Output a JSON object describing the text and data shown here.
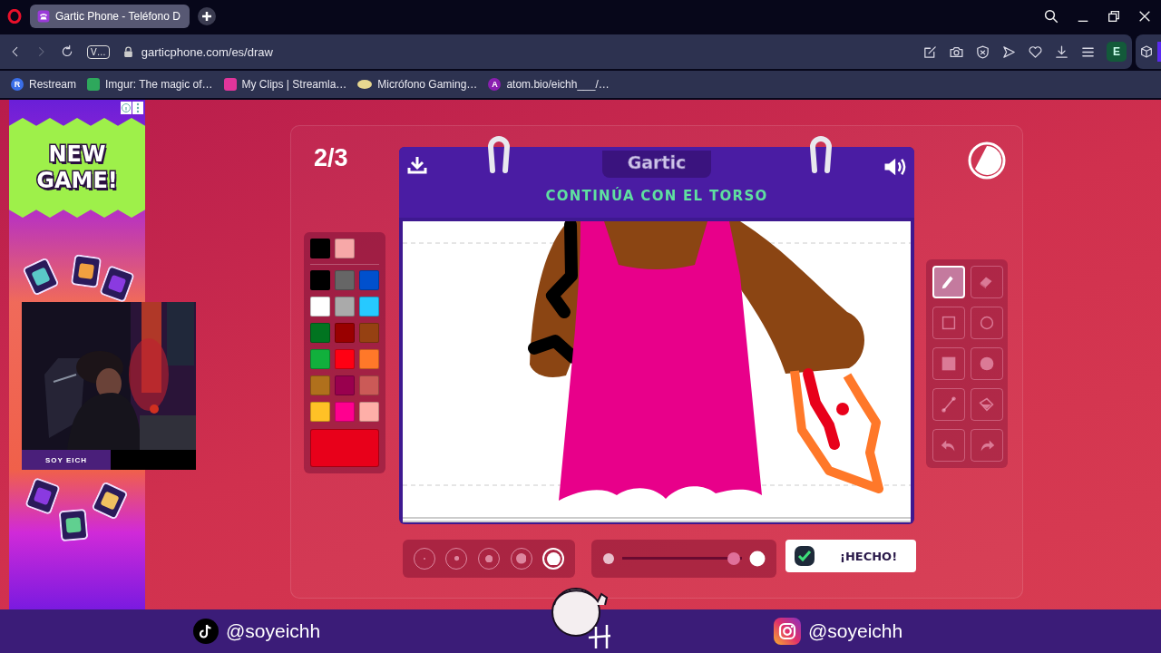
{
  "browser": {
    "tab": {
      "title": "Gartic Phone - Teléfono D",
      "selected": true
    },
    "forward_disabled": true,
    "site_badge": "V…",
    "url": "garticphone.com/es/draw",
    "profile_initial": "E",
    "bookmarks": [
      {
        "kind": "letter",
        "badge": "R",
        "color": "#3a6ee8",
        "label": "Restream"
      },
      {
        "kind": "square",
        "color": "#2ea85c",
        "label": "Imgur: The magic of…"
      },
      {
        "kind": "square",
        "color": "#e0359a",
        "label": "My Clips | Streamla…"
      },
      {
        "kind": "oval",
        "color": "#e8d890",
        "label": "Micrófono Gaming…"
      },
      {
        "kind": "letter",
        "badge": "A",
        "color": "#8a1fb0",
        "label": "atom.bio/eichh___/…"
      }
    ]
  },
  "ad": {
    "headline": "NEW GAME!"
  },
  "webcam": {
    "kind": "picture",
    "caption": "SOY EICH"
  },
  "game": {
    "round": "2/3",
    "logo": "Gartic",
    "prompt": "CONTINÚA CON EL TORSO",
    "recent_colors": [
      {
        "color": "#000000"
      },
      {
        "color": "#f7a8a8"
      }
    ],
    "colors": [
      {
        "color": "#000000"
      },
      {
        "color": "#666666"
      },
      {
        "color": "#0050cd"
      },
      {
        "color": "#ffffff"
      },
      {
        "color": "#aaaaaa"
      },
      {
        "color": "#26c9ff"
      },
      {
        "color": "#017420"
      },
      {
        "color": "#990000"
      },
      {
        "color": "#964112"
      },
      {
        "color": "#11b03c"
      },
      {
        "color": "#ff0013"
      },
      {
        "color": "#ff7829"
      },
      {
        "color": "#b0701c"
      },
      {
        "color": "#99004e"
      },
      {
        "color": "#cb5a57"
      },
      {
        "color": "#ffc126"
      },
      {
        "color": "#ff008f"
      },
      {
        "color": "#feafa8"
      }
    ],
    "current_color": {
      "color": "#e8001a"
    },
    "tools": [
      {
        "kind": "pencil",
        "selected": true
      },
      {
        "kind": "eraser",
        "selected": false
      },
      {
        "kind": "rect-outline",
        "selected": false
      },
      {
        "kind": "circle-outline",
        "selected": false
      },
      {
        "kind": "rect-fill",
        "selected": false
      },
      {
        "kind": "circle-fill",
        "selected": false
      },
      {
        "kind": "line",
        "selected": false
      },
      {
        "kind": "bucket",
        "selected": false
      },
      {
        "kind": "undo",
        "selected": false
      },
      {
        "kind": "redo",
        "selected": false
      }
    ],
    "brush_sizes": [
      {
        "selected": false
      },
      {
        "selected": false
      },
      {
        "selected": false
      },
      {
        "selected": false
      },
      {
        "selected": true
      }
    ],
    "opacity": {
      "level": 0.93
    },
    "done_button": "¡HECHO!"
  },
  "overlay": {
    "socials": [
      {
        "kind": "tiktok",
        "handle": "@soyeichh"
      },
      {
        "kind": "instagram",
        "handle": "@soyeichh"
      }
    ]
  }
}
